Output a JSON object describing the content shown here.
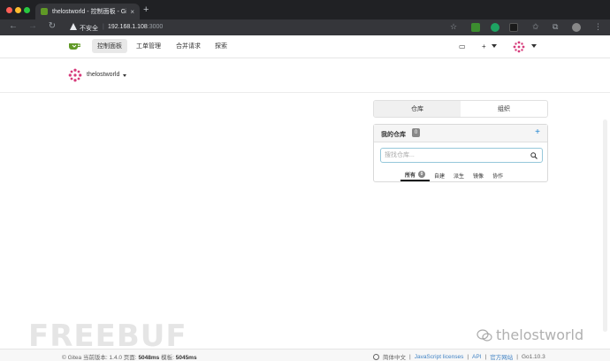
{
  "browser": {
    "tab_title": "thelostworld - 控制面板 - Gitea",
    "tab_close": "×",
    "new_tab": "+",
    "insecure_label": "不安全",
    "separator": "|",
    "url_host": "192.168.1.108",
    "url_port": ":3000"
  },
  "header": {
    "menu": [
      {
        "label": "控制面板",
        "active": true
      },
      {
        "label": "工单管理"
      },
      {
        "label": "合并请求"
      },
      {
        "label": "探索"
      }
    ],
    "add_symbol": "+"
  },
  "dashboard": {
    "username": "thelostworld"
  },
  "panel": {
    "segments": [
      "仓库",
      "组织"
    ],
    "repo_title": "我的仓库",
    "repo_count": "0",
    "add_symbol": "+",
    "search_placeholder": "搜找仓库...",
    "filters": [
      {
        "label": "所有",
        "badge": "0",
        "active": true
      },
      {
        "label": "自建"
      },
      {
        "label": "派生"
      },
      {
        "label": "镜像"
      },
      {
        "label": "协作"
      }
    ]
  },
  "footer": {
    "left_prefix": "© Gitea 当前版本: 1.4.0 页面: ",
    "page_time": "5048ms",
    "template_label": " 模板: ",
    "template_time": "5045ms",
    "language": "简体中文",
    "sep": "|",
    "links": [
      "JavaScript licenses",
      "API",
      "官方网站"
    ],
    "go_version": "Go1.10.3"
  },
  "watermarks": {
    "freebuf": "FREEBUF",
    "wechat": "thelostworld"
  },
  "colors": {
    "gitea_green": "#609926",
    "link_blue": "#4183c4",
    "add_blue": "#2185d0"
  }
}
